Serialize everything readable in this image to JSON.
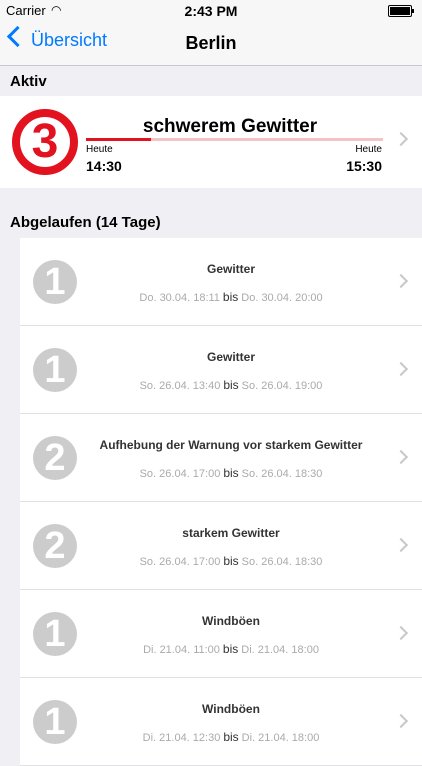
{
  "status": {
    "carrier": "Carrier",
    "time": "2:43 PM"
  },
  "nav": {
    "back_label": "Übersicht",
    "title": "Berlin"
  },
  "active": {
    "header": "Aktiv",
    "level": "3",
    "title": "schwerem Gewitter",
    "progress_fraction": 0.22,
    "start_day": "Heute",
    "start_time": "14:30",
    "end_day": "Heute",
    "end_time": "15:30",
    "color": "#e2121e"
  },
  "expired": {
    "header": "Abgelaufen (14 Tage)",
    "bis": "bis",
    "items": [
      {
        "level": "1",
        "title": "Gewitter",
        "from": "Do. 30.04. 18:11",
        "to": "Do. 30.04. 20:00"
      },
      {
        "level": "1",
        "title": "Gewitter",
        "from": "So. 26.04. 13:40",
        "to": "So. 26.04. 19:00"
      },
      {
        "level": "2",
        "title": "Aufhebung der Warnung vor starkem Gewitter",
        "from": "So. 26.04. 17:00",
        "to": "So. 26.04. 18:30"
      },
      {
        "level": "2",
        "title": "starkem Gewitter",
        "from": "So. 26.04. 17:00",
        "to": "So. 26.04. 18:30"
      },
      {
        "level": "1",
        "title": "Windböen",
        "from": "Di. 21.04. 11:00",
        "to": "Di. 21.04. 18:00"
      },
      {
        "level": "1",
        "title": "Windböen",
        "from": "Di. 21.04. 12:30",
        "to": "Di. 21.04. 18:00"
      }
    ]
  }
}
